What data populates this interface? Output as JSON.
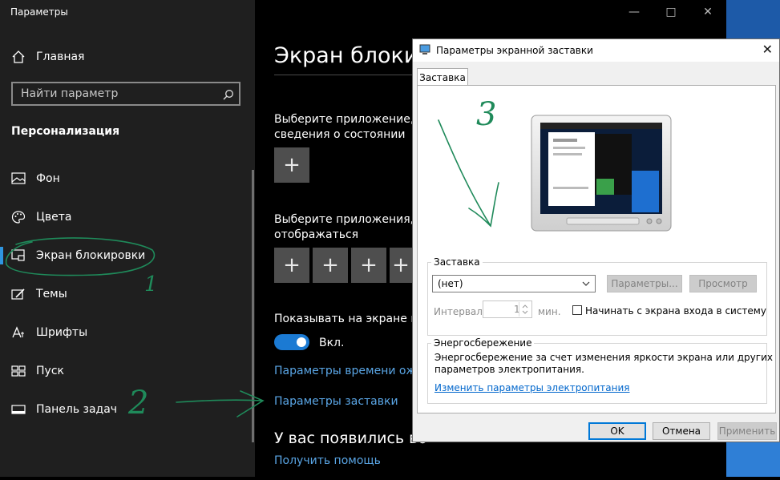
{
  "settings": {
    "window_title": "Параметры",
    "nav_home": "Главная",
    "search_placeholder": "Найти параметр",
    "section": "Персонализация",
    "nav": [
      {
        "label": "Фон",
        "icon": "image-icon"
      },
      {
        "label": "Цвета",
        "icon": "palette-icon"
      },
      {
        "label": "Экран блокировки",
        "icon": "lock-screen-icon"
      },
      {
        "label": "Темы",
        "icon": "brush-icon"
      },
      {
        "label": "Шрифты",
        "icon": "font-icon"
      },
      {
        "label": "Пуск",
        "icon": "start-icon"
      },
      {
        "label": "Панель задач",
        "icon": "taskbar-icon"
      }
    ],
    "page_title": "Экран блокир",
    "detail_text_1": "Выберите приложение, дл",
    "detail_text_1b": "сведения о состоянии",
    "detail_text_2": "Выберите приложения, кр",
    "detail_text_2b": "отображаться",
    "show_bg_text": "Показывать на экране вход",
    "toggle_state": "Вкл.",
    "link_timeout": "Параметры времени ожид",
    "link_screensaver": "Параметры заставки",
    "question_heading": "У вас появились во",
    "link_help": "Получить помощь",
    "accent_color": "#2f96e0"
  },
  "dialog": {
    "title": "Параметры экранной заставки",
    "tab": "Заставка",
    "screensaver_group": "Заставка",
    "screensaver_value": "(нет)",
    "btn_params": "Параметры...",
    "btn_preview": "Просмотр",
    "interval_label": "Интервал:",
    "interval_value": "1",
    "interval_unit": "мин.",
    "resume_checkbox": "Начинать с экрана входа в систему",
    "power_group": "Энергосбережение",
    "power_text_1": "Энергосбережение за счет изменения яркости экрана или других",
    "power_text_2": "параметров электропитания.",
    "power_link": "Изменить параметры электропитания",
    "btn_ok": "OK",
    "btn_cancel": "Отмена",
    "btn_apply": "Применить"
  },
  "annotations": {
    "mark_1": "1",
    "mark_2": "2",
    "mark_3": "3",
    "ink_color": "#1f8a5a"
  }
}
